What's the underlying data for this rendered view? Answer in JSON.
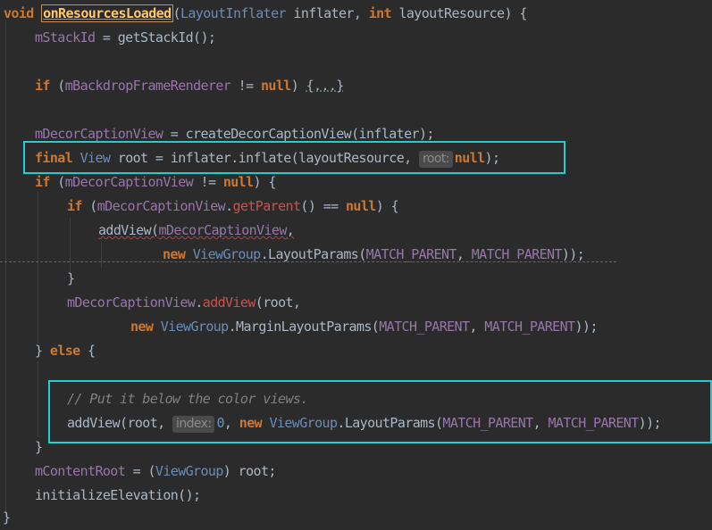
{
  "code": {
    "line1": {
      "kw_void": "void",
      "method": "onResourcesLoaded",
      "open": "(",
      "type1": "LayoutInflater",
      "p1": " inflater, ",
      "kw_int": "int",
      "p2": " layoutResource) {"
    },
    "line2": {
      "field": "mStackId",
      "rest": " = getStackId();"
    },
    "line4": {
      "kw_if": "if",
      "open": " (",
      "field": "mBackdropFrameRenderer",
      "op": " != ",
      "kw_null": "null",
      "close": ") ",
      "fold": "{...}"
    },
    "line6": {
      "field": "mDecorCaptionView",
      "rest": " = createDecorCaptionView(inflater);"
    },
    "line7": {
      "kw_final": "final",
      "type": "View",
      "rest": " root = inflater.inflate(layoutResource, ",
      "hint": "root:",
      "kw_null": "null",
      "end": ");"
    },
    "line8": {
      "kw_if": "if",
      "open": " (",
      "field": "mDecorCaptionView",
      "op": " != ",
      "kw_null": "null",
      "close": ") {"
    },
    "line9": {
      "kw_if": "if",
      "open": " (",
      "field": "mDecorCaptionView",
      "dot": ".",
      "method": "getParent",
      "rest": "() == ",
      "kw_null": "null",
      "close": ") {"
    },
    "line10": {
      "call": "addView(",
      "field": "mDecorCaptionView",
      "end": ","
    },
    "line11": {
      "kw_new": "new",
      "type": "ViewGroup",
      "rest": ".LayoutParams(",
      "c1": "MATCH_PARENT",
      "sep": ", ",
      "c2": "MATCH_PARENT",
      "end": "));"
    },
    "line12": {
      "brace": "}"
    },
    "line13": {
      "field": "mDecorCaptionView",
      "dot": ".",
      "method": "addView",
      "rest": "(root,"
    },
    "line14": {
      "kw_new": "new",
      "type": "ViewGroup",
      "rest": ".MarginLayoutParams(",
      "c1": "MATCH_PARENT",
      "sep": ", ",
      "c2": "MATCH_PARENT",
      "end": "));"
    },
    "line15": {
      "brace": "} ",
      "kw_else": "else",
      "open": " {"
    },
    "line17": {
      "comment": "// Put it below the color views."
    },
    "line18": {
      "call": "addView(root, ",
      "hint": "index:",
      "num": "0",
      "sep": ", ",
      "kw_new": "new",
      "type": "ViewGroup",
      "rest": ".LayoutParams(",
      "c1": "MATCH_PARENT",
      "sep2": ", ",
      "c2": "MATCH_PARENT",
      "end": "));"
    },
    "line19": {
      "brace": "}"
    },
    "line20": {
      "field": "mContentRoot",
      "rest": " = (",
      "type": "ViewGroup",
      "end": ") root;"
    },
    "line21": {
      "call": "initializeElevation();"
    },
    "line22": {
      "brace": "}"
    }
  },
  "colors": {
    "background": "#2b2b2b",
    "keyword": "#cc7832",
    "field": "#9876aa",
    "type": "#6a8db8",
    "method": "#ffc66d",
    "comment": "#808080",
    "highlight_box": "#1fcfcf"
  }
}
